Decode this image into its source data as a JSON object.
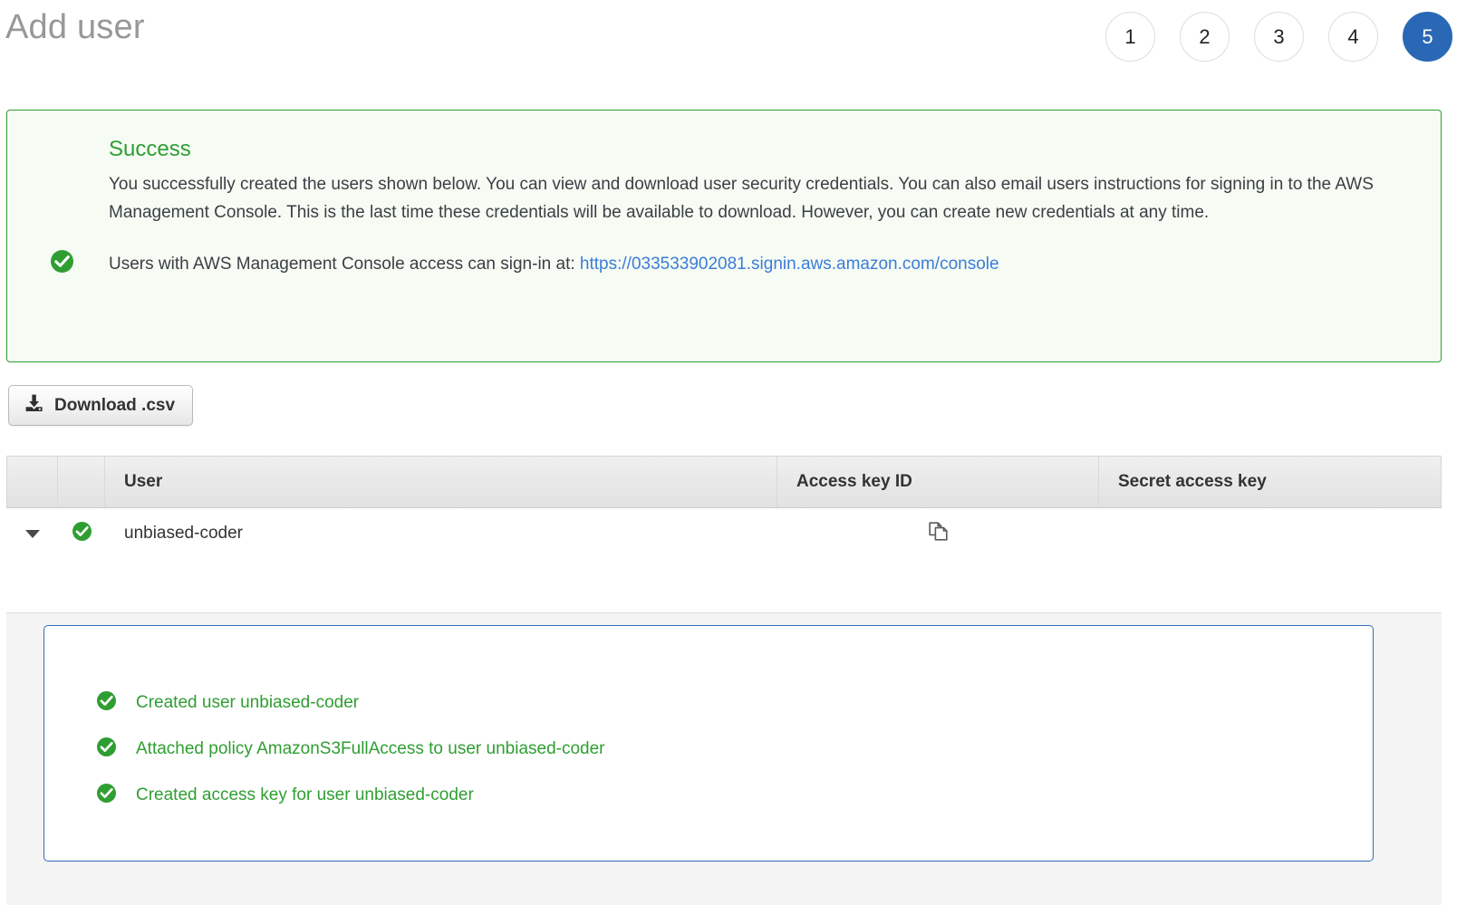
{
  "header": {
    "title": "Add user",
    "steps": [
      {
        "label": "1",
        "active": false
      },
      {
        "label": "2",
        "active": false
      },
      {
        "label": "3",
        "active": false
      },
      {
        "label": "4",
        "active": false
      },
      {
        "label": "5",
        "active": true
      }
    ],
    "active_step_color": "#2a68b5"
  },
  "alert": {
    "icon": "check-circle-icon",
    "heading": "Success",
    "body_paragraph": "You successfully created the users shown below. You can view and download user security credentials. You can also email users instructions for signing in to the AWS Management Console. This is the last time these credentials will be available to download. However, you can create new credentials at any time.",
    "signin_prefix": "Users with AWS Management Console access can sign-in at: ",
    "signin_url": "https://033533902081.signin.aws.amazon.com/console",
    "border_color": "#2f9e32",
    "background_color": "#f6fbf4",
    "heading_color": "#2f9e32",
    "link_color": "#3b7dd8"
  },
  "toolbar": {
    "download_label": "Download .csv",
    "download_icon": "download-icon"
  },
  "table": {
    "columns": [
      {
        "key": "toggle",
        "label": ""
      },
      {
        "key": "status",
        "label": ""
      },
      {
        "key": "user",
        "label": "User"
      },
      {
        "key": "access_key_id",
        "label": "Access key ID"
      },
      {
        "key": "secret_access_key",
        "label": "Secret access key"
      }
    ],
    "rows": [
      {
        "expanded": true,
        "toggle_icon": "caret-down-icon",
        "status_icon": "check-circle-icon",
        "user": "unbiased-coder",
        "access_key_id": "",
        "access_key_id_copy_icon": "copy-icon",
        "secret_access_key": ""
      }
    ]
  },
  "detail_panel": {
    "border_color": "#2e6db4",
    "background_color": "#f4f4f4",
    "items": [
      {
        "icon": "check-circle-icon",
        "label": "Created user unbiased-coder"
      },
      {
        "icon": "check-circle-icon",
        "label": "Attached policy AmazonS3FullAccess to user unbiased-coder"
      },
      {
        "icon": "check-circle-icon",
        "label": "Created access key for user unbiased-coder"
      }
    ],
    "text_color": "#2f9e32"
  }
}
